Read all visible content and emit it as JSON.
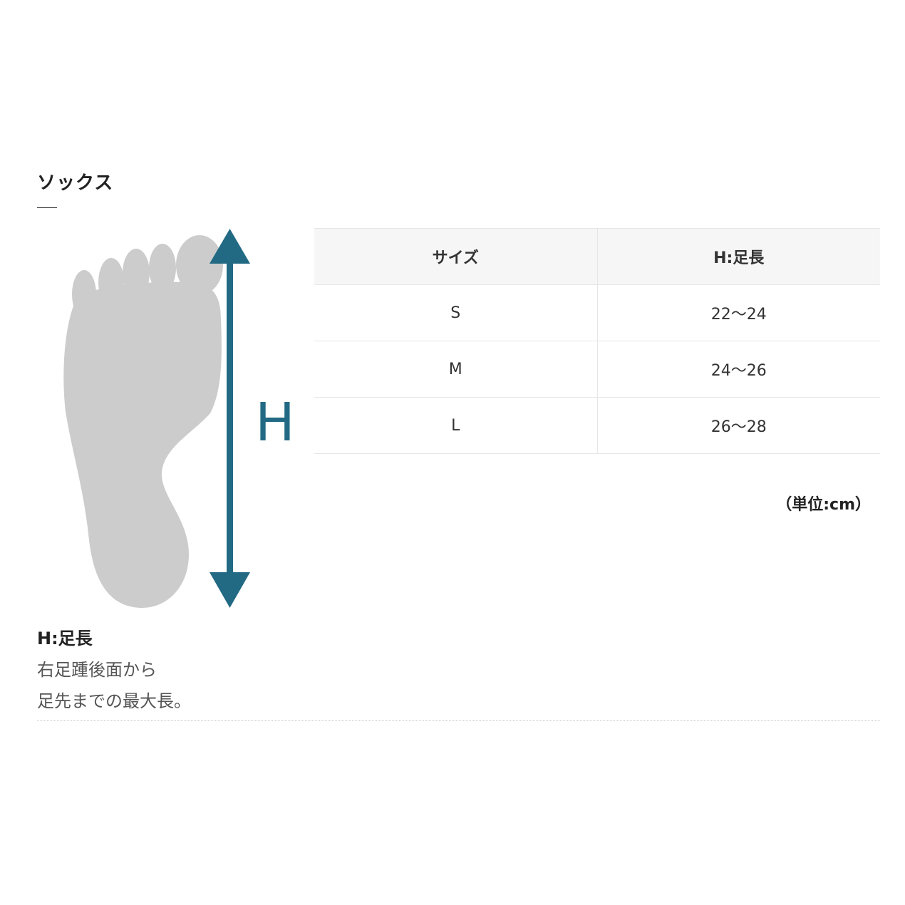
{
  "section": {
    "title": "ソックス"
  },
  "figure": {
    "dimension_letter": "H",
    "colors": {
      "foot": "#cccccc",
      "arrow": "#226a84"
    },
    "icons": [
      "foot-sole-illustration",
      "double-arrow"
    ]
  },
  "size_table": {
    "headers": [
      "サイズ",
      "H:足長"
    ],
    "rows": [
      {
        "size": "S",
        "foot_length": "22〜24"
      },
      {
        "size": "M",
        "foot_length": "24〜26"
      },
      {
        "size": "L",
        "foot_length": "26〜28"
      }
    ]
  },
  "unit_note": "（単位:cm）",
  "legend": {
    "title": "H:足長",
    "description_lines": [
      "右足踵後面から",
      "足先までの最大長。"
    ]
  }
}
